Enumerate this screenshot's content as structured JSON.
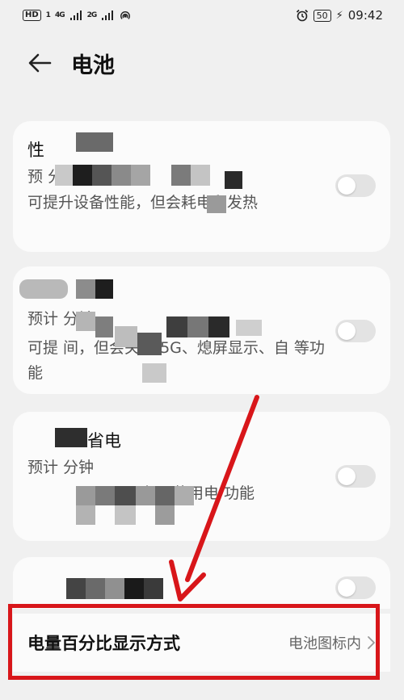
{
  "status_bar": {
    "hd": "HD",
    "sim": "1",
    "net1": "4G",
    "net2": "2G",
    "battery": "50",
    "time": "09:42"
  },
  "header": {
    "title": "电池",
    "back_icon": "arrow-left-icon"
  },
  "cards": [
    {
      "title": "性",
      "subtitle": "预 分钟",
      "description": "可提升设备性能，但会耗电和发热",
      "toggle_on": false
    },
    {
      "title": "",
      "subtitle": "预计 分钟",
      "description": "可提 间，但会关闭 5G、熄屏显示、自 等功能",
      "toggle_on": false
    },
    {
      "title": "省电",
      "subtitle": "预计 分钟",
      "description": "仅可使用电 功能",
      "toggle_on": false
    },
    {
      "title": "",
      "toggle_on": false
    }
  ],
  "percentage_setting": {
    "label": "电量百分比显示方式",
    "value": "电池图标内"
  },
  "colors": {
    "highlight": "#d8161a",
    "background": "#f0f0f0",
    "card": "#fbfbfb"
  }
}
